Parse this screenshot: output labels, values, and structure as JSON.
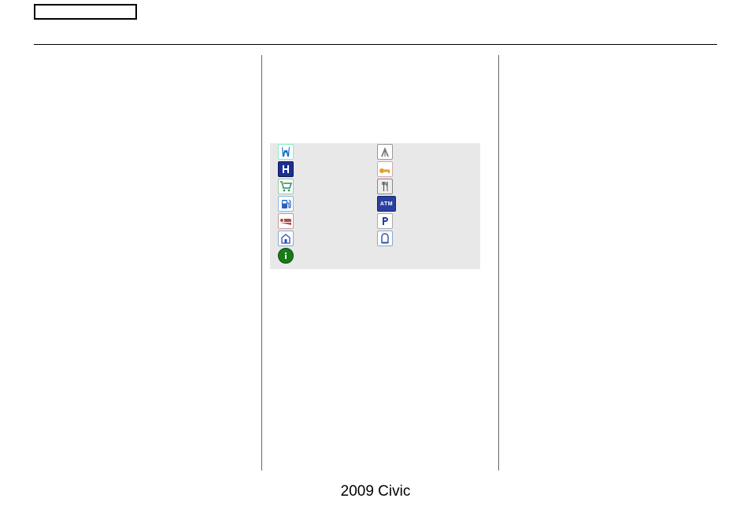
{
  "footer": "2009  Civic",
  "icons": {
    "row0": {
      "left": "honda-dealer-icon",
      "right": "acura-dealer-icon"
    },
    "row1": {
      "left": "hospital-icon",
      "right": "key-icon"
    },
    "row2": {
      "left": "shopping-cart-icon",
      "right": "restaurant-icon"
    },
    "row3": {
      "left": "gas-station-icon",
      "right": "atm-icon"
    },
    "row4": {
      "left": "lodging-icon",
      "right": "parking-icon"
    },
    "row5": {
      "left": "post-office-icon",
      "right": "rest-area-icon"
    },
    "row6": {
      "left": "tourist-info-icon"
    }
  },
  "atm_label": "ATM"
}
